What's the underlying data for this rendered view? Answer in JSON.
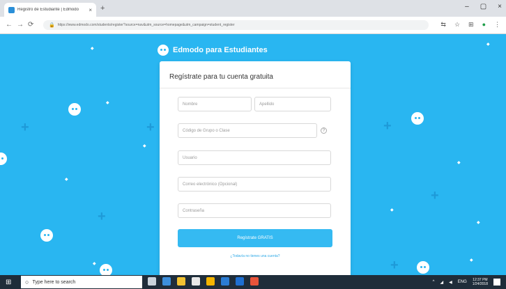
{
  "browser": {
    "tab_title": "Registro de Estudiante | Edmodo",
    "tab_close": "×",
    "new_tab": "+",
    "window_controls": [
      "–",
      "▢",
      "×"
    ],
    "nav": [
      "←",
      "→",
      "⟳"
    ],
    "url": "https://www.edmodo.com/students/register?source=nav&utm_source=homepage&utm_campaign=student_register",
    "extensions": [
      "⇆",
      "☆",
      "⊞",
      "●",
      "⋮"
    ]
  },
  "page": {
    "brand_name": "Edmodo para Estudiantes",
    "form": {
      "title": "Regístrate para tu cuenta gratuita",
      "first_name_placeholder": "Nombre",
      "last_name_placeholder": "Apellido",
      "group_code_placeholder": "Código de Grupo o Clase",
      "username_placeholder": "Usuario",
      "email_placeholder": "Correo electrónico (Opcional)",
      "password_placeholder": "Contraseña",
      "help_icon": "?",
      "submit_label": "Regístrate GRATIS",
      "login_link": "¿Todavía no tienes una cuenta?"
    }
  },
  "taskbar": {
    "start_icon": "⊞",
    "search_placeholder": "Type here to search",
    "search_icon": "○",
    "tray_arrow": "^",
    "language": "ENG",
    "time": "12:37 PM",
    "date": "1/24/2018"
  },
  "colors": {
    "background": "#29b6f1",
    "accent": "#35baf2",
    "taskbar": "#1f2d3a"
  }
}
